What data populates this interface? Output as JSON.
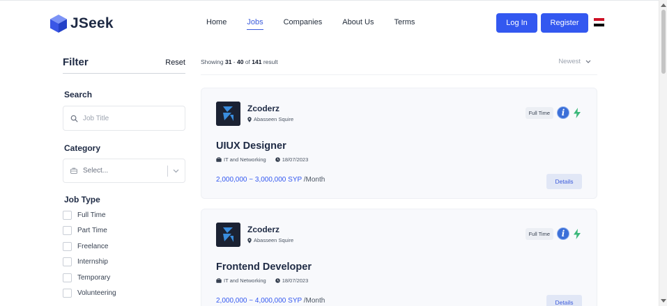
{
  "header": {
    "logo_text": "JSeek",
    "nav": [
      {
        "label": "Home",
        "active": false
      },
      {
        "label": "Jobs",
        "active": true
      },
      {
        "label": "Companies",
        "active": false
      },
      {
        "label": "About Us",
        "active": false
      },
      {
        "label": "Terms",
        "active": false
      }
    ],
    "login_label": "Log In",
    "register_label": "Register",
    "brand_color": "#3358f0",
    "flag_colors": [
      "#ce1126",
      "#ffffff",
      "#000000"
    ]
  },
  "filter": {
    "title": "Filter",
    "reset_label": "Reset",
    "search_label": "Search",
    "search_placeholder": "Job Title",
    "category_label": "Category",
    "category_value": "Select...",
    "job_type_label": "Job Type",
    "job_types": [
      "Full Time",
      "Part Time",
      "Freelance",
      "Internship",
      "Temporary",
      "Volunteering"
    ]
  },
  "results": {
    "prefix": "Showing ",
    "from": "31",
    "sep": " - ",
    "to": "40",
    "of": " of ",
    "total": "141",
    "suffix": " result",
    "sort_label": "Newest"
  },
  "jobs": [
    {
      "company": "Zcoderz",
      "location": "Abasseen Squire",
      "type": "Full Time",
      "title": "UIUX Designer",
      "category": "IT and Networking",
      "date": "18/07/2023",
      "salary": "2,000,000 ~ 3,000,000 SYP",
      "period": " /Month",
      "details_label": "Details"
    },
    {
      "company": "Zcoderz",
      "location": "Abasseen Squire",
      "type": "Full Time",
      "title": "Frontend Developer",
      "category": "IT and Networking",
      "date": "18/07/2023",
      "salary": "2,000,000 ~ 4,000,000 SYP",
      "period": " /Month",
      "details_label": "Details"
    }
  ]
}
